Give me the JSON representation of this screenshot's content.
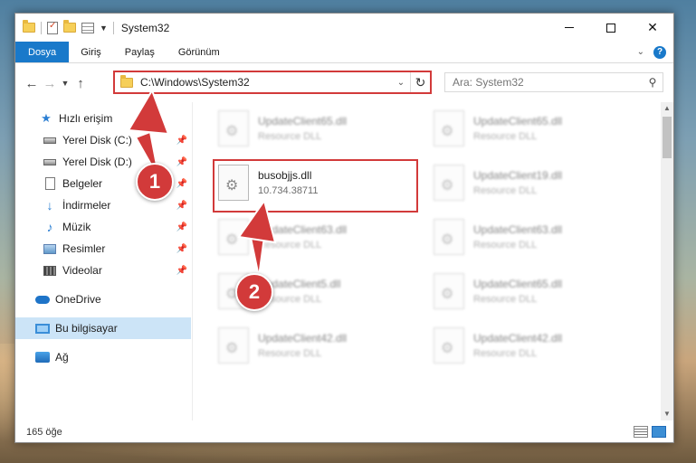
{
  "window": {
    "title": "System32",
    "controls": {
      "minimize": "",
      "maximize": "",
      "close": "✕"
    }
  },
  "ribbon": {
    "tabs": [
      {
        "label": "Dosya"
      },
      {
        "label": "Giriş"
      },
      {
        "label": "Paylaş"
      },
      {
        "label": "Görünüm"
      }
    ],
    "help": "?"
  },
  "address_bar": {
    "path": "C:\\Windows\\System32"
  },
  "search": {
    "placeholder": "Ara: System32"
  },
  "sidebar": {
    "items": [
      {
        "label": "Hızlı erişim",
        "icon": "star-icon"
      },
      {
        "label": "Yerel Disk (C:)",
        "icon": "disk-icon",
        "pinned": true
      },
      {
        "label": "Yerel Disk (D:)",
        "icon": "disk-icon",
        "pinned": true
      },
      {
        "label": "Belgeler",
        "icon": "documents-icon",
        "pinned": true
      },
      {
        "label": "İndirmeler",
        "icon": "download-icon",
        "pinned": true
      },
      {
        "label": "Müzik",
        "icon": "music-icon",
        "pinned": true
      },
      {
        "label": "Resimler",
        "icon": "pictures-icon",
        "pinned": true
      },
      {
        "label": "Videolar",
        "icon": "videos-icon",
        "pinned": true
      },
      {
        "label": "OneDrive",
        "icon": "onedrive-icon"
      },
      {
        "label": "Bu bilgisayar",
        "icon": "this-pc-icon",
        "selected": true
      },
      {
        "label": "Ağ",
        "icon": "network-icon"
      }
    ]
  },
  "files": [
    {
      "name": "UpdateClient65.dll",
      "type": "Resource DLL",
      "blurred": true
    },
    {
      "name": "UpdateClient65.dll",
      "type": "Resource DLL",
      "blurred": true
    },
    {
      "name": "busobjjs.dll",
      "type": "10.734.38711",
      "blurred": false,
      "highlighted": true
    },
    {
      "name": "UpdateClient19.dll",
      "type": "Resource DLL",
      "blurred": true
    },
    {
      "name": "UpdateClient63.dll",
      "type": "Resource DLL",
      "blurred": true
    },
    {
      "name": "UpdateClient63.dll",
      "type": "Resource DLL",
      "blurred": true
    },
    {
      "name": "UpdateClient5.dll",
      "type": "Resource DLL",
      "blurred": true
    },
    {
      "name": "UpdateClient65.dll",
      "type": "Resource DLL",
      "blurred": true
    },
    {
      "name": "UpdateClient42.dll",
      "type": "Resource DLL",
      "blurred": true
    },
    {
      "name": "UpdateClient42.dll",
      "type": "Resource DLL",
      "blurred": true
    }
  ],
  "status": {
    "item_count": "165 öğe"
  },
  "callouts": [
    {
      "label": "1"
    },
    {
      "label": "2"
    }
  ],
  "colors": {
    "accent": "#1979ca",
    "highlight": "#d23a3a",
    "selected_nav": "#cce4f7"
  }
}
